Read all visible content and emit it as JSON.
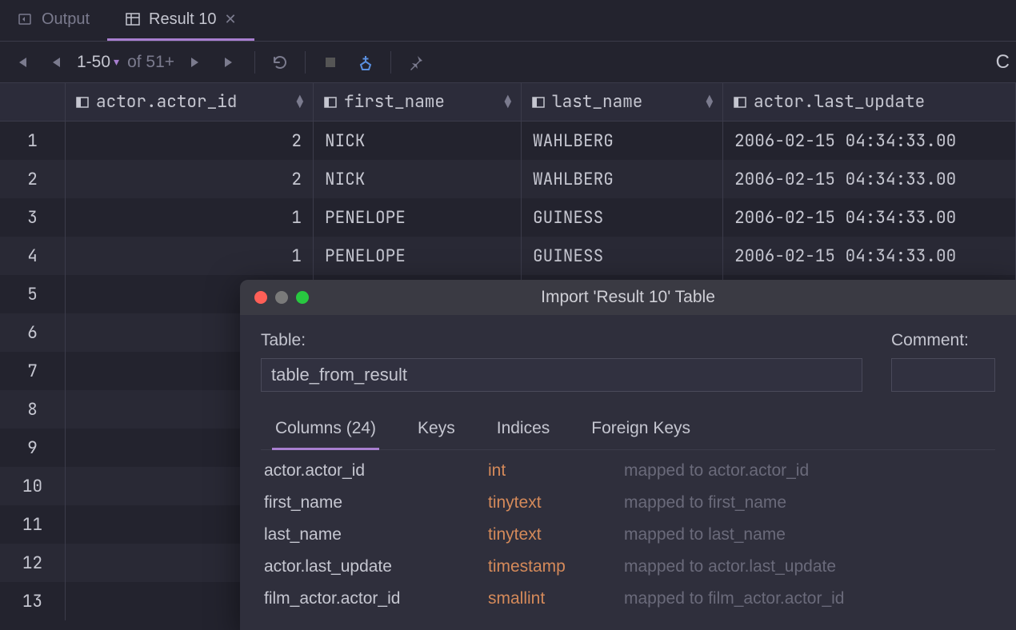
{
  "tabs": {
    "output": "Output",
    "result": "Result 10"
  },
  "toolbar": {
    "range": "1-50",
    "total": "of 51+"
  },
  "columns": [
    {
      "label": "actor.actor_id"
    },
    {
      "label": "first_name"
    },
    {
      "label": "last_name"
    },
    {
      "label": "actor.last_update"
    }
  ],
  "rows": [
    {
      "n": "1",
      "id": "2",
      "fn": "NICK",
      "ln": "WAHLBERG",
      "lu": "2006-02-15 04:34:33.00"
    },
    {
      "n": "2",
      "id": "2",
      "fn": "NICK",
      "ln": "WAHLBERG",
      "lu": "2006-02-15 04:34:33.00"
    },
    {
      "n": "3",
      "id": "1",
      "fn": "PENELOPE",
      "ln": "GUINESS",
      "lu": "2006-02-15 04:34:33.00"
    },
    {
      "n": "4",
      "id": "1",
      "fn": "PENELOPE",
      "ln": "GUINESS",
      "lu": "2006-02-15 04:34:33.00"
    },
    {
      "n": "5",
      "id": "",
      "fn": "",
      "ln": "",
      "lu": ""
    },
    {
      "n": "6",
      "id": "",
      "fn": "",
      "ln": "",
      "lu": ""
    },
    {
      "n": "7",
      "id": "",
      "fn": "",
      "ln": "",
      "lu": ""
    },
    {
      "n": "8",
      "id": "",
      "fn": "",
      "ln": "",
      "lu": ""
    },
    {
      "n": "9",
      "id": "",
      "fn": "",
      "ln": "",
      "lu": ""
    },
    {
      "n": "10",
      "id": "",
      "fn": "",
      "ln": "",
      "lu": ""
    },
    {
      "n": "11",
      "id": "",
      "fn": "",
      "ln": "",
      "lu": ""
    },
    {
      "n": "12",
      "id": "",
      "fn": "",
      "ln": "",
      "lu": ""
    },
    {
      "n": "13",
      "id": "",
      "fn": "",
      "ln": "",
      "lu": ""
    }
  ],
  "dialog": {
    "title": "Import 'Result 10' Table",
    "table_label": "Table:",
    "table_value": "table_from_result",
    "comment_label": "Comment:",
    "comment_value": "",
    "tabs": {
      "columns": "Columns (24)",
      "keys": "Keys",
      "indices": "Indices",
      "foreign_keys": "Foreign Keys"
    },
    "col_list": [
      {
        "name": "actor.actor_id",
        "type": "int",
        "mapped": "mapped to actor.actor_id"
      },
      {
        "name": "first_name",
        "type": "tinytext",
        "mapped": "mapped to first_name"
      },
      {
        "name": "last_name",
        "type": "tinytext",
        "mapped": "mapped to last_name"
      },
      {
        "name": "actor.last_update",
        "type": "timestamp",
        "mapped": "mapped to actor.last_update"
      },
      {
        "name": "film_actor.actor_id",
        "type": "smallint",
        "mapped": "mapped to film_actor.actor_id"
      }
    ]
  }
}
